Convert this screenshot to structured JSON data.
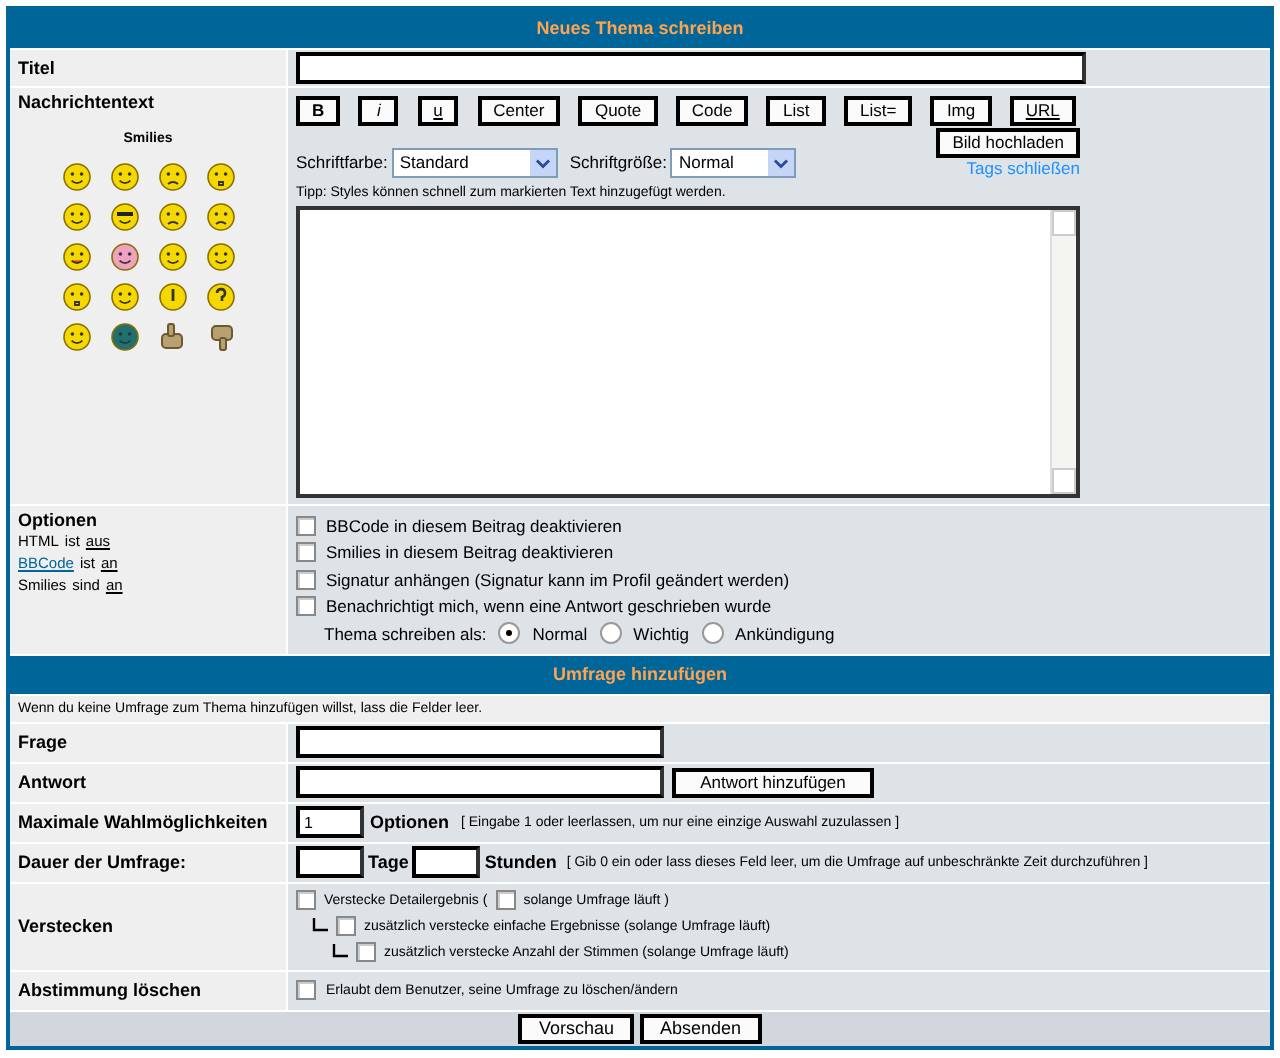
{
  "header": "Neues Thema schreiben",
  "title_row": {
    "label": "Titel"
  },
  "message": {
    "label": "Nachrichtentext",
    "smilies_label": "Smilies",
    "format_buttons": [
      {
        "label": "B",
        "kind": "bold"
      },
      {
        "label": "i",
        "kind": "italic"
      },
      {
        "label": "u",
        "kind": "underline"
      },
      {
        "label": "Center",
        "kind": "plain"
      },
      {
        "label": "Quote",
        "kind": "plain"
      },
      {
        "label": "Code",
        "kind": "plain"
      },
      {
        "label": "List",
        "kind": "plain"
      },
      {
        "label": "List=",
        "kind": "plain"
      },
      {
        "label": "Img",
        "kind": "plain"
      },
      {
        "label": "URL",
        "kind": "underline"
      }
    ],
    "upload_button": "Bild hochladen",
    "close_tags_link": "Tags schließen",
    "font_color": {
      "label": "Schriftfarbe:",
      "value": "Standard"
    },
    "font_size": {
      "label": "Schriftgröße:",
      "value": "Normal"
    },
    "tip": "Tipp: Styles können schnell zum markierten Text hinzugefügt werden."
  },
  "options": {
    "label": "Optionen",
    "status": [
      {
        "subject": "HTML",
        "subject_link": false,
        "verb": "ist",
        "value": "aus"
      },
      {
        "subject": "BBCode",
        "subject_link": true,
        "verb": "ist",
        "value": "an"
      },
      {
        "subject": "Smilies",
        "subject_link": false,
        "verb": "sind",
        "value": "an"
      }
    ],
    "checkboxes": [
      {
        "label": "BBCode in diesem Beitrag deaktivieren",
        "checked": false
      },
      {
        "label": "Smilies in diesem Beitrag deaktivieren",
        "checked": false
      },
      {
        "label": "Signatur anhängen (Signatur kann im Profil geändert werden)",
        "checked": false
      },
      {
        "label": "Benachrichtigt mich, wenn eine Antwort geschrieben wurde",
        "checked": false
      }
    ],
    "post_type": {
      "label": "Thema schreiben als:",
      "choices": [
        {
          "label": "Normal",
          "selected": true
        },
        {
          "label": "Wichtig",
          "selected": false
        },
        {
          "label": "Ankündigung",
          "selected": false
        }
      ]
    }
  },
  "poll": {
    "header": "Umfrage hinzufügen",
    "hint": "Wenn du keine Umfrage zum Thema hinzufügen willst, lass die Felder leer.",
    "question_label": "Frage",
    "answer_label": "Antwort",
    "add_answer_button": "Antwort hinzufügen",
    "max_choices": {
      "label": "Maximale Wahlmöglichkeiten",
      "value": "1",
      "unit": "Optionen",
      "note": "[ Eingabe 1 oder leerlassen, um nur eine einzige Auswahl zuzulassen ]"
    },
    "duration": {
      "label": "Dauer der Umfrage:",
      "days_unit": "Tage",
      "hours_unit": "Stunden",
      "note": "[ Gib 0 ein oder lass dieses Feld leer, um die Umfrage auf unbeschränkte Zeit durchzuführen ]"
    },
    "hide": {
      "label": "Verstecken",
      "items": [
        {
          "label": "Verstecke Detailergebnis (",
          "checked": false,
          "inline": {
            "label": "solange Umfrage läuft )",
            "checked": false
          },
          "children": [
            {
              "label": "zusätzlich verstecke einfache Ergebnisse (solange Umfrage läuft)",
              "checked": false,
              "children": [
                {
                  "label": "zusätzlich verstecke Anzahl der Stimmen (solange Umfrage läuft)",
                  "checked": false
                }
              ]
            }
          ]
        }
      ]
    },
    "delete": {
      "label": "Abstimmung löschen",
      "checkbox": {
        "label": "Erlaubt dem Benutzer, seine Umfrage zu löschen/ändern",
        "checked": false
      }
    }
  },
  "buttons": [
    "Vorschau",
    "Absenden"
  ]
}
